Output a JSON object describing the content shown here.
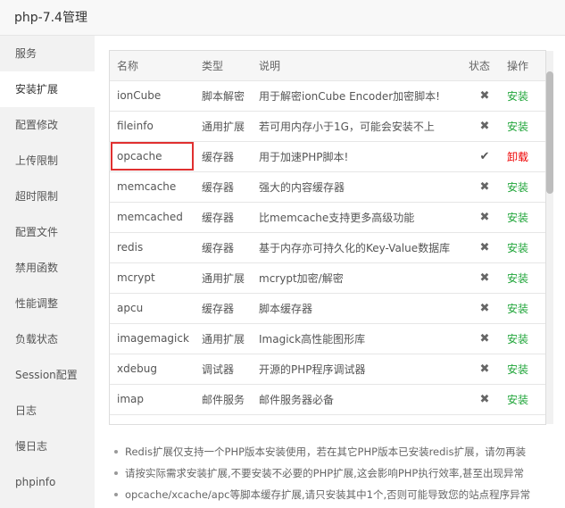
{
  "window": {
    "title": "php-7.4管理"
  },
  "sidebar": {
    "items": [
      {
        "label": "服务",
        "active": false
      },
      {
        "label": "安装扩展",
        "active": true
      },
      {
        "label": "配置修改",
        "active": false
      },
      {
        "label": "上传限制",
        "active": false
      },
      {
        "label": "超时限制",
        "active": false
      },
      {
        "label": "配置文件",
        "active": false
      },
      {
        "label": "禁用函数",
        "active": false
      },
      {
        "label": "性能调整",
        "active": false
      },
      {
        "label": "负载状态",
        "active": false
      },
      {
        "label": "Session配置",
        "active": false
      },
      {
        "label": "日志",
        "active": false
      },
      {
        "label": "慢日志",
        "active": false
      },
      {
        "label": "phpinfo",
        "active": false
      }
    ]
  },
  "table": {
    "headers": {
      "name": "名称",
      "type": "类型",
      "desc": "说明",
      "status": "状态",
      "action": "操作"
    },
    "rows": [
      {
        "name": "ionCube",
        "type": "脚本解密",
        "desc": "用于解密ionCube Encoder加密脚本!",
        "installed": false,
        "action": "安装"
      },
      {
        "name": "fileinfo",
        "type": "通用扩展",
        "desc": "若可用内存小于1G，可能会安装不上",
        "installed": false,
        "action": "安装"
      },
      {
        "name": "opcache",
        "type": "缓存器",
        "desc": "用于加速PHP脚本!",
        "installed": true,
        "action": "卸载"
      },
      {
        "name": "memcache",
        "type": "缓存器",
        "desc": "强大的内容缓存器",
        "installed": false,
        "action": "安装"
      },
      {
        "name": "memcached",
        "type": "缓存器",
        "desc": "比memcache支持更多高级功能",
        "installed": false,
        "action": "安装"
      },
      {
        "name": "redis",
        "type": "缓存器",
        "desc": "基于内存亦可持久化的Key-Value数据库",
        "installed": false,
        "action": "安装"
      },
      {
        "name": "mcrypt",
        "type": "通用扩展",
        "desc": "mcrypt加密/解密",
        "installed": false,
        "action": "安装"
      },
      {
        "name": "apcu",
        "type": "缓存器",
        "desc": "脚本缓存器",
        "installed": false,
        "action": "安装"
      },
      {
        "name": "imagemagick",
        "type": "通用扩展",
        "desc": "Imagick高性能图形库",
        "installed": false,
        "action": "安装"
      },
      {
        "name": "xdebug",
        "type": "调试器",
        "desc": "开源的PHP程序调试器",
        "installed": false,
        "action": "安装"
      },
      {
        "name": "imap",
        "type": "邮件服务",
        "desc": "邮件服务器必备",
        "installed": false,
        "action": "安装"
      }
    ]
  },
  "notes": [
    "Redis扩展仅支持一个PHP版本安装使用，若在其它PHP版本已安装redis扩展，请勿再装",
    "请按实际需求安装扩展,不要安装不必要的PHP扩展,这会影响PHP执行效率,甚至出现异常",
    "opcache/xcache/apc等脚本缓存扩展,请只安装其中1个,否则可能导致您的站点程序异常"
  ],
  "colors": {
    "install": "#20a53a",
    "uninstall": "#ee0000",
    "highlight": "#e03030"
  },
  "icons": {
    "not_installed": "x-icon",
    "installed": "check-icon"
  }
}
